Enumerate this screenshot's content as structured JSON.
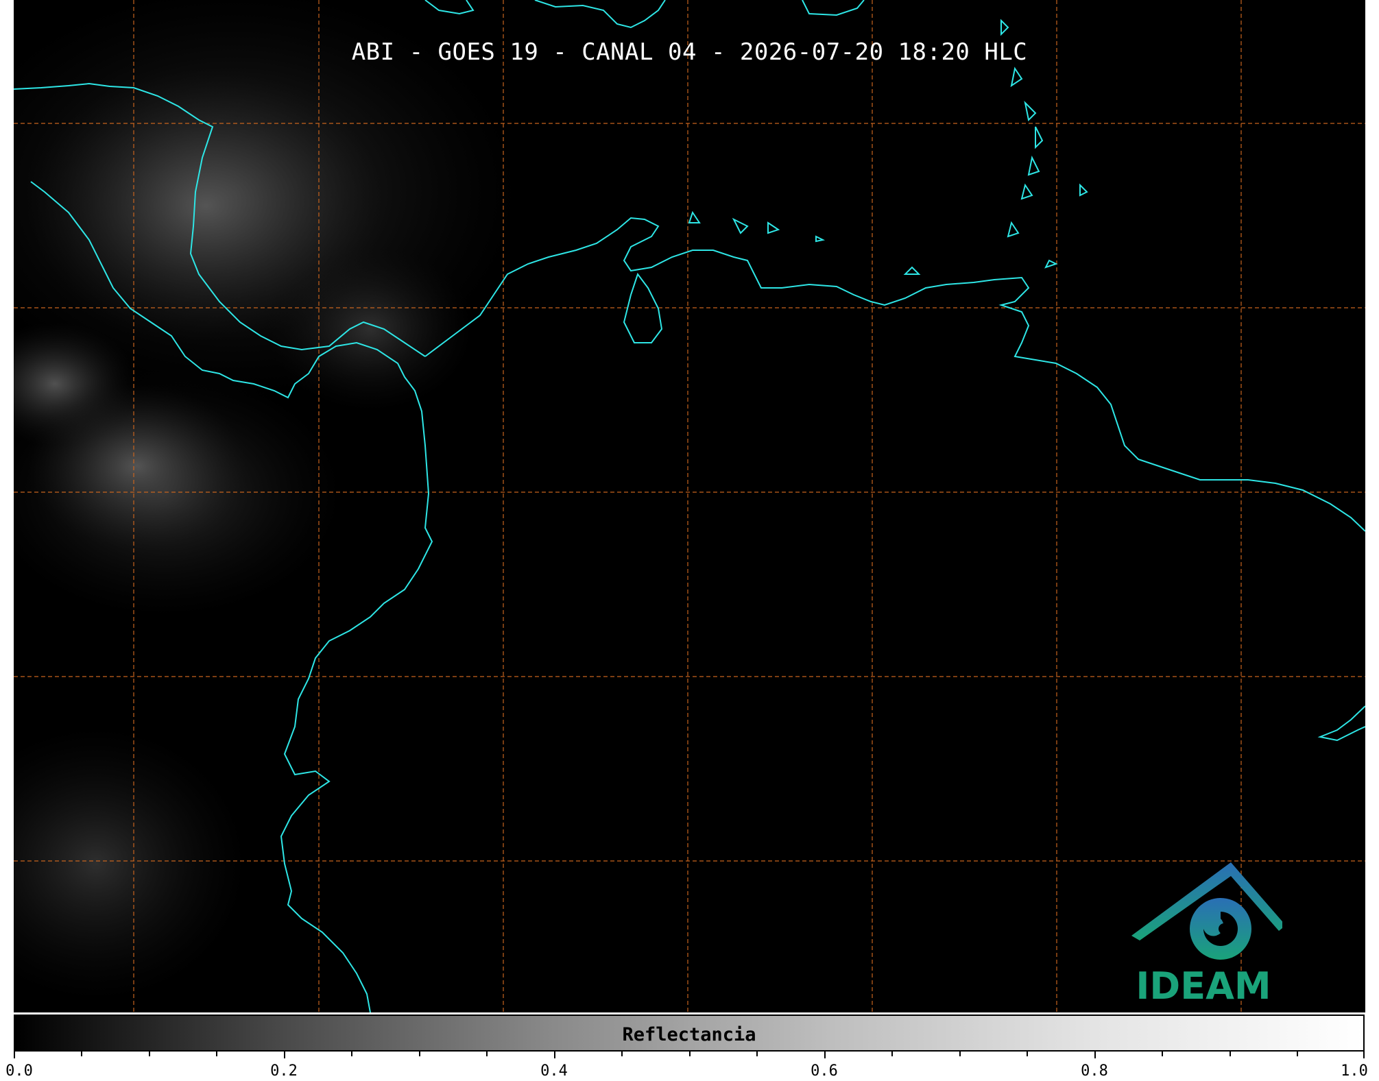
{
  "title": "ABI - GOES 19 - CANAL 04 - 2026-07-20 18:20 HLC",
  "colorbar": {
    "label": "Reflectancia",
    "ticks": [
      "0.0",
      "0.2",
      "0.4",
      "0.6",
      "0.8",
      "1.0"
    ],
    "range": [
      0.0,
      1.0
    ]
  },
  "logo": {
    "text": "IDEAM",
    "icon": "ideam-logo-icon"
  },
  "colors": {
    "coastline": "#2ee6e6",
    "gridline": "#c8641e",
    "background": "#000000"
  }
}
